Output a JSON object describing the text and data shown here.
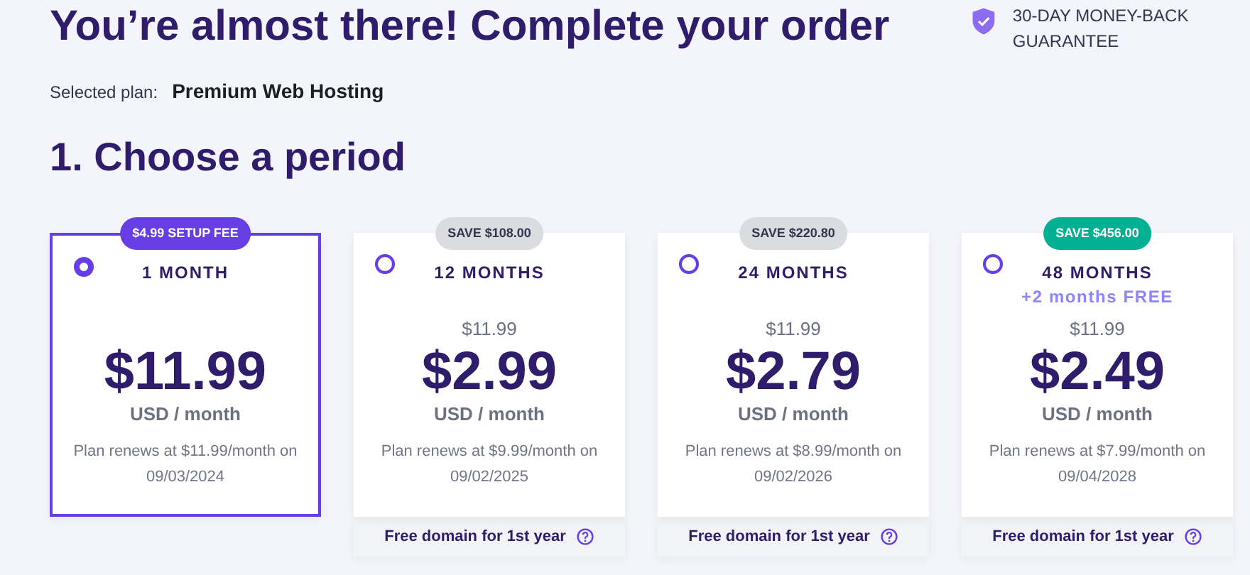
{
  "title": "You’re almost there! Complete your order",
  "guarantee": "30-DAY MONEY-BACK GUARANTEE",
  "selected_plan": {
    "label": "Selected plan:",
    "value": "Premium Web Hosting"
  },
  "section_title": "1. Choose a period",
  "plans": [
    {
      "badge": {
        "text": "$4.99 SETUP FEE",
        "kind": "fee"
      },
      "selected": true,
      "period": "1 MONTH",
      "price": "$11.99",
      "unit": "USD / month",
      "renewal": "Plan renews at $11.99/month on 09/03/2024"
    },
    {
      "badge": {
        "text": "SAVE $108.00",
        "kind": "save"
      },
      "selected": false,
      "period": "12 MONTHS",
      "old_price": "$11.99",
      "price": "$2.99",
      "unit": "USD / month",
      "renewal": "Plan renews at $9.99/month on 09/02/2025",
      "footer": "Free domain for 1st year"
    },
    {
      "badge": {
        "text": "SAVE $220.80",
        "kind": "save"
      },
      "selected": false,
      "period": "24 MONTHS",
      "old_price": "$11.99",
      "price": "$2.79",
      "unit": "USD / month",
      "renewal": "Plan renews at $8.99/month on 09/02/2026",
      "footer": "Free domain for 1st year"
    },
    {
      "badge": {
        "text": "SAVE $456.00",
        "kind": "best"
      },
      "selected": false,
      "period": "48 MONTHS",
      "extra": "+2 months FREE",
      "old_price": "$11.99",
      "price": "$2.49",
      "unit": "USD / month",
      "renewal": "Plan renews at $7.99/month on 09/04/2028",
      "footer": "Free domain for 1st year"
    }
  ]
}
